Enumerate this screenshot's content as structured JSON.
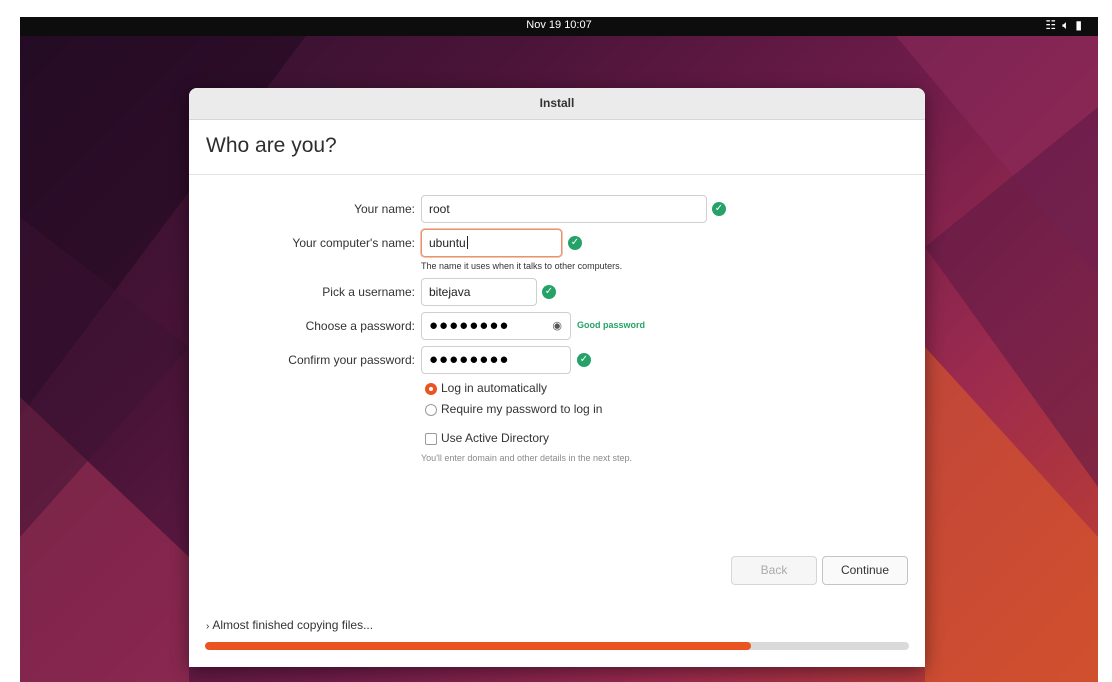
{
  "topbar": {
    "clock": "Nov 19  10:07",
    "tray_icons": [
      "network-icon",
      "volume-icon",
      "battery-icon"
    ]
  },
  "window": {
    "title": "Install"
  },
  "page": {
    "heading": "Who are you?"
  },
  "form": {
    "name_label": "Your name:",
    "name_value": "root",
    "computer_label": "Your computer's name:",
    "computer_value": "ubuntu",
    "computer_hint": "The name it uses when it talks to other computers.",
    "username_label": "Pick a username:",
    "username_value": "bitejava",
    "password_label": "Choose a password:",
    "password_dots": "●●●●●●●●",
    "password_strength": "Good password",
    "confirm_label": "Confirm your password:",
    "confirm_dots": "●●●●●●●●"
  },
  "login": {
    "auto_label": "Log in automatically",
    "auto_selected": true,
    "require_label": "Require my password to log in",
    "require_selected": false
  },
  "ad": {
    "label": "Use Active Directory",
    "checked": false,
    "hint": "You'll enter domain and other details in the next step."
  },
  "buttons": {
    "back": "Back",
    "continue": "Continue"
  },
  "status": {
    "text": "Almost finished copying files..."
  },
  "progress": {
    "fraction": 0.775
  },
  "colors": {
    "accent": "#e95420",
    "success": "#26a269"
  }
}
